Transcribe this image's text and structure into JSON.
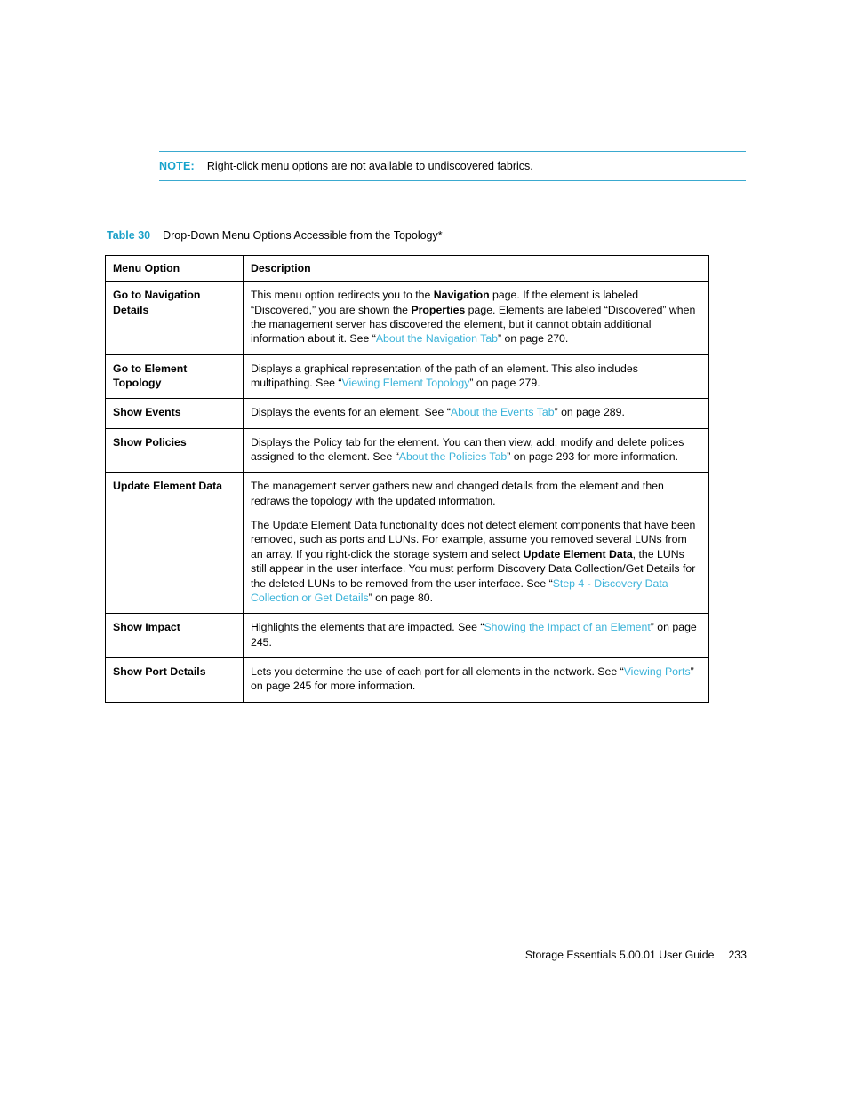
{
  "note": {
    "label": "NOTE:",
    "text": "Right-click menu options are not available to undiscovered fabrics."
  },
  "caption": {
    "number": "Table 30",
    "text": "Drop-Down Menu Options Accessible from the Topology*"
  },
  "table": {
    "headers": {
      "option": "Menu Option",
      "description": "Description"
    },
    "rows": [
      {
        "option": "Go to Navigation Details",
        "description_parts": [
          {
            "t": "This menu option redirects you to the ",
            "s": "plain"
          },
          {
            "t": "Navigation",
            "s": "bold"
          },
          {
            "t": " page. If the element is labeled “Discovered,” you are shown the ",
            "s": "plain"
          },
          {
            "t": "Properties",
            "s": "bold"
          },
          {
            "t": " page. Elements are labeled “Discovered” when the management server has discovered the element, but it cannot obtain additional information about it. See “",
            "s": "plain"
          },
          {
            "t": "About the Navigation Tab",
            "s": "link"
          },
          {
            "t": "” on page 270.",
            "s": "plain"
          }
        ]
      },
      {
        "option": "Go to Element Topology",
        "description_parts": [
          {
            "t": "Displays a graphical representation of the path of an element. This also includes multipathing. See “",
            "s": "plain"
          },
          {
            "t": "Viewing Element Topology",
            "s": "link"
          },
          {
            "t": "” on page 279.",
            "s": "plain"
          }
        ]
      },
      {
        "option": "Show Events",
        "description_parts": [
          {
            "t": "Displays the events for an element. See “",
            "s": "plain"
          },
          {
            "t": "About the Events Tab",
            "s": "link"
          },
          {
            "t": "” on page 289.",
            "s": "plain"
          }
        ]
      },
      {
        "option": "Show Policies",
        "description_parts": [
          {
            "t": "Displays the Policy tab for the element. You can then view, add, modify and delete polices assigned to the element. See “",
            "s": "plain"
          },
          {
            "t": "About the Policies Tab",
            "s": "link"
          },
          {
            "t": "” on page 293 for more information.",
            "s": "plain"
          }
        ]
      },
      {
        "option": "Update Element Data",
        "description_parts": [
          {
            "t": "The management server gathers new and changed details from the element and then redraws the topology with the updated information.",
            "s": "plain"
          },
          {
            "t": "",
            "s": "break"
          },
          {
            "t": "The Update Element Data functionality does not detect element components that have been removed, such as ports and LUNs. For example, assume you removed several LUNs from an array. If you right-click the storage system and select ",
            "s": "plain"
          },
          {
            "t": "Update Element Data",
            "s": "bold"
          },
          {
            "t": ", the LUNs still appear in the user interface. You must perform Discovery Data Collection/Get Details for the deleted LUNs to be removed from the user interface. See “",
            "s": "plain"
          },
          {
            "t": "Step 4 - Discovery Data Collection or Get Details",
            "s": "link"
          },
          {
            "t": "” on page 80.",
            "s": "plain"
          }
        ]
      },
      {
        "option": "Show Impact",
        "description_parts": [
          {
            "t": "Highlights the elements that are impacted. See “",
            "s": "plain"
          },
          {
            "t": "Showing the Impact of an Element",
            "s": "link"
          },
          {
            "t": "” on page 245.",
            "s": "plain"
          }
        ]
      },
      {
        "option": "Show Port Details",
        "description_parts": [
          {
            "t": "Lets you determine the use of each port for all elements in the network. See “",
            "s": "plain"
          },
          {
            "t": "Viewing Ports",
            "s": "link"
          },
          {
            "t": "” on page 245 for more information.",
            "s": "plain"
          }
        ]
      }
    ]
  },
  "footer": {
    "title": "Storage Essentials 5.00.01 User Guide",
    "page": "233"
  },
  "colors": {
    "link": "#3bb3d9",
    "accent": "#17a3cc"
  }
}
